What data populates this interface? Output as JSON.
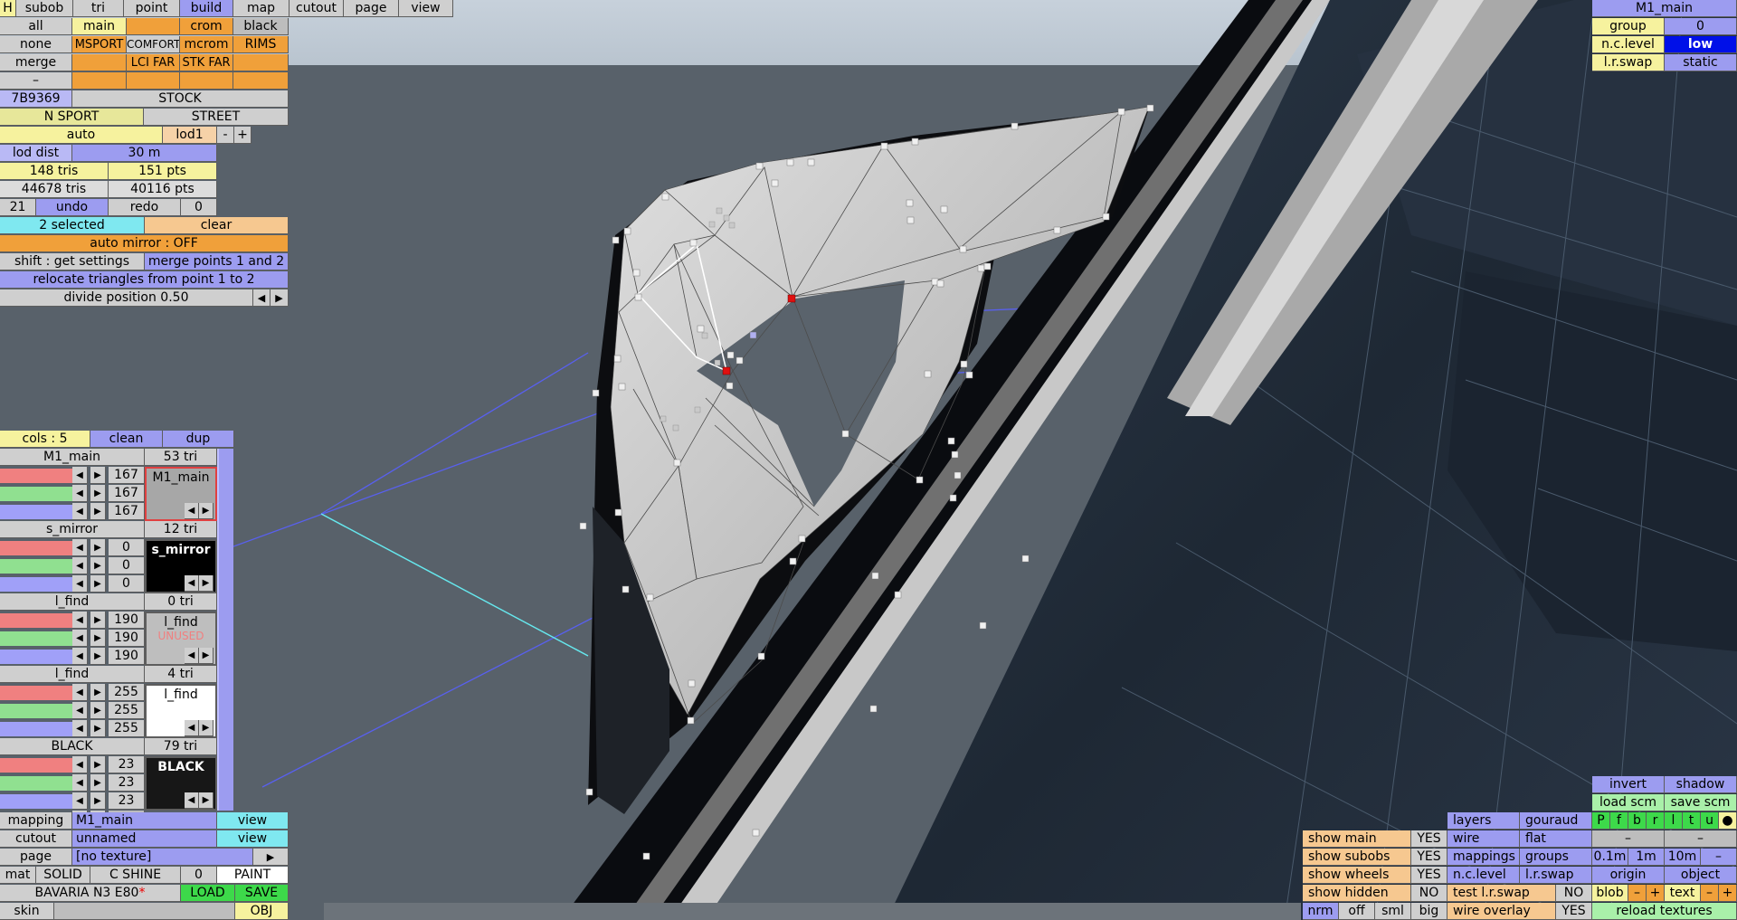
{
  "top_menu": {
    "h": "H",
    "tabs": [
      "subob",
      "tri",
      "point",
      "build",
      "map",
      "cutout",
      "page",
      "view"
    ],
    "active_tab": "build"
  },
  "filters": {
    "row1": [
      "all",
      "main",
      "",
      "crom",
      "black"
    ],
    "row2": [
      "none",
      "MSPORT",
      "COMFORT",
      "mcrom",
      "RIMS"
    ],
    "row3": [
      "merge",
      "",
      "LCI FAR",
      "STK FAR",
      ""
    ],
    "row4": [
      "–",
      "",
      "",
      "",
      ""
    ],
    "id": "7B9369",
    "stock": "STOCK",
    "nsport": "N SPORT",
    "street": "STREET",
    "auto": "auto",
    "lod": "lod1",
    "minus": "-",
    "plus": "+"
  },
  "stats": {
    "lod_dist_label": "lod dist",
    "lod_dist_value": "30 m",
    "tris": "148 tris",
    "pts": "151 pts",
    "total_tris": "44678 tris",
    "total_pts": "40116 pts",
    "undo_count": "21",
    "undo": "undo",
    "redo": "redo",
    "redo_count": "0"
  },
  "selection": {
    "selected": "2 selected",
    "clear": "clear",
    "auto_mirror": "auto mirror : OFF",
    "shift": "shift : get settings",
    "merge": "merge points 1 and 2",
    "relocate": "relocate triangles from point 1 to 2",
    "divide": "divide position 0.50",
    "left": "◀",
    "right": "▶"
  },
  "materials_header": {
    "cols": "cols : 5",
    "clean": "clean",
    "dup": "dup"
  },
  "materials": [
    {
      "name": "M1_main",
      "tris": "53 tri",
      "r": "167",
      "g": "167",
      "b": "167",
      "preview": "M1_main",
      "preview_bg": "#a7a7a7",
      "preview_fg": "#000000",
      "note": ""
    },
    {
      "name": "s_mirror",
      "tris": "12 tri",
      "r": "0",
      "g": "0",
      "b": "0",
      "preview": "s_mirror",
      "preview_bg": "#000000",
      "preview_fg": "#ffffff",
      "note": ""
    },
    {
      "name": "l_find",
      "tris": "0 tri",
      "r": "190",
      "g": "190",
      "b": "190",
      "preview": "l_find",
      "preview_bg": "#bebebe",
      "preview_fg": "#000000",
      "note": "UNUSED"
    },
    {
      "name": "l_find",
      "tris": "4 tri",
      "r": "255",
      "g": "255",
      "b": "255",
      "preview": "l_find",
      "preview_bg": "#ffffff",
      "preview_fg": "#000000",
      "note": ""
    },
    {
      "name": "BLACK",
      "tris": "79 tri",
      "r": "23",
      "g": "23",
      "b": "23",
      "preview": "BLACK",
      "preview_bg": "#171717",
      "preview_fg": "#ffffff",
      "note": ""
    }
  ],
  "bottom_left": {
    "mapping_label": "mapping",
    "mapping_value": "M1_main",
    "mapping_view": "view",
    "cutout_label": "cutout",
    "cutout_value": "unnamed",
    "cutout_view": "view",
    "page_label": "page",
    "page_value": "[no texture]",
    "page_arrow": "▶",
    "mat": "mat",
    "solid": "SOLID",
    "cshine": "C SHINE",
    "cshine_val": "0",
    "paint": "PAINT",
    "file": "BAVARIA N3 E80",
    "modified": "*",
    "load": "LOAD",
    "save": "SAVE",
    "skin": "skin",
    "obj": "OBJ"
  },
  "top_right": {
    "title": "M1_main",
    "group_label": "group",
    "group_value": "0",
    "nclevel_label": "n.c.level",
    "nclevel_value": "low",
    "lrswap_label": "l.r.swap",
    "lrswap_value": "static"
  },
  "bottom_right": {
    "invert": "invert",
    "shadow": "shadow",
    "load_scm": "load scm",
    "save_scm": "save scm",
    "view_letters": [
      "P",
      "f",
      "b",
      "r",
      "l",
      "t",
      "u",
      "●"
    ],
    "dash": "–",
    "show_main": "show main",
    "show_main_val": "YES",
    "show_subobs": "show subobs",
    "show_subobs_val": "YES",
    "show_wheels": "show wheels",
    "show_wheels_val": "YES",
    "show_hidden": "show hidden",
    "show_hidden_val": "NO",
    "nrm": "nrm",
    "off": "off",
    "sml": "sml",
    "big": "big",
    "layers": "layers",
    "gouraud": "gouraud",
    "wire": "wire",
    "flat": "flat",
    "mappings": "mappings",
    "groups": "groups",
    "nclevel": "n.c.level",
    "lrswap": "l.r.swap",
    "test_lrswap": "test l.r.swap",
    "test_lrswap_val": "NO",
    "wire_overlay": "wire overlay",
    "wire_overlay_val": "YES",
    "grid_01": "0.1m",
    "grid_1": "1m",
    "grid_10": "10m",
    "grid_minus": "–",
    "origin": "origin",
    "object": "object",
    "blob": "blob",
    "blob_minus": "–",
    "blob_plus": "+",
    "text": "text",
    "text_minus": "–",
    "text_plus": "+",
    "reload": "reload textures"
  },
  "colors": {
    "accent_blue": "#9c9cf0",
    "accent_orange": "#f0a03a",
    "active_green": "#3dd94a",
    "selected_point": "#e01010"
  }
}
